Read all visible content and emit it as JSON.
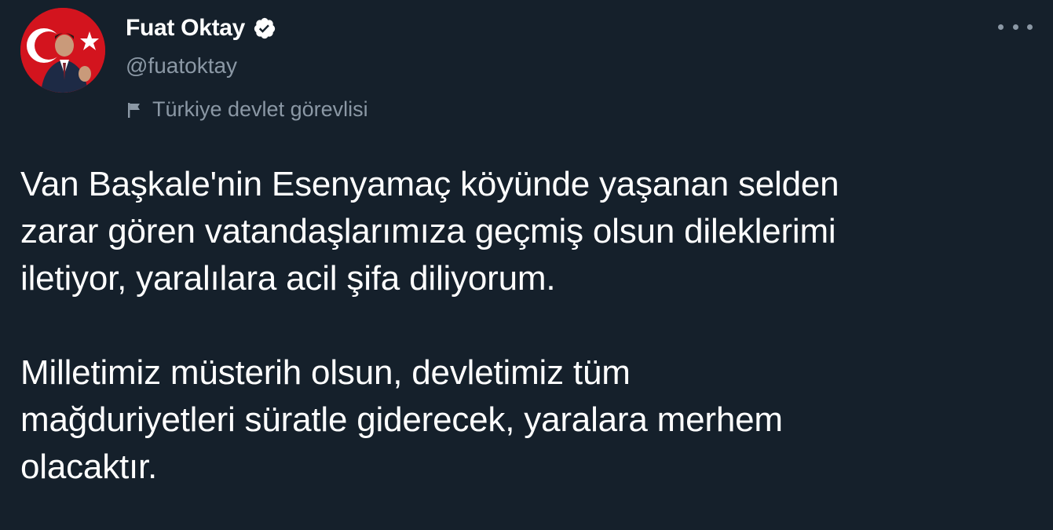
{
  "author": {
    "display_name": "Fuat Oktay",
    "handle": "@fuatoktay",
    "verified_icon": "verified-badge-icon",
    "affiliation_label": "Türkiye devlet görevlisi",
    "affiliation_icon": "flag-icon",
    "avatar_icon": "profile-avatar"
  },
  "actions": {
    "more_icon": "more-options-icon"
  },
  "tweet": {
    "paragraphs": [
      "Van Başkale'nin Esenyamaç köyünde yaşanan selden\nzarar gören vatandaşlarımıza geçmiş olsun dileklerimi\niletiyor, yaralılara acil şifa diliyorum.",
      "Milletimiz müsterih olsun, devletimiz tüm\nmağduriyetleri süratle giderecek, yaralara merhem\nolacaktır."
    ]
  },
  "colors": {
    "background": "#15202b",
    "primary_text": "#ffffff",
    "secondary_text": "#8b98a5",
    "avatar_red": "#d3141e"
  }
}
